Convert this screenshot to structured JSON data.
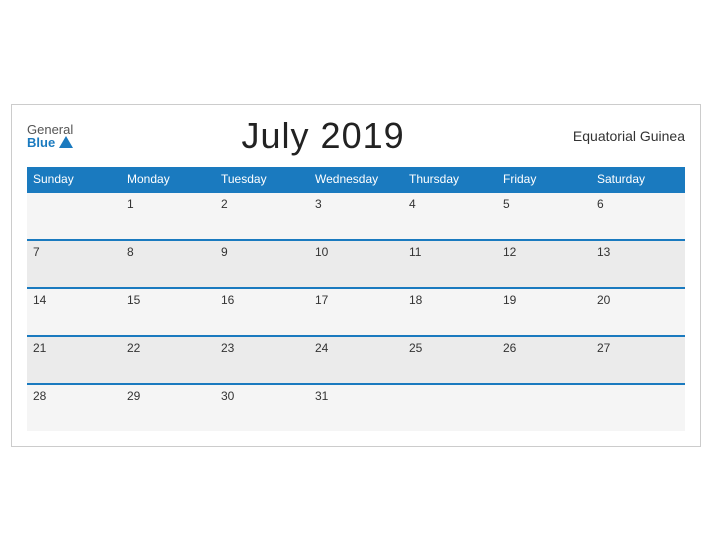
{
  "header": {
    "logo_general": "General",
    "logo_blue": "Blue",
    "month_title": "July 2019",
    "country": "Equatorial Guinea"
  },
  "days": [
    "Sunday",
    "Monday",
    "Tuesday",
    "Wednesday",
    "Thursday",
    "Friday",
    "Saturday"
  ],
  "weeks": [
    [
      "",
      "1",
      "2",
      "3",
      "4",
      "5",
      "6"
    ],
    [
      "7",
      "8",
      "9",
      "10",
      "11",
      "12",
      "13"
    ],
    [
      "14",
      "15",
      "16",
      "17",
      "18",
      "19",
      "20"
    ],
    [
      "21",
      "22",
      "23",
      "24",
      "25",
      "26",
      "27"
    ],
    [
      "28",
      "29",
      "30",
      "31",
      "",
      "",
      ""
    ]
  ]
}
